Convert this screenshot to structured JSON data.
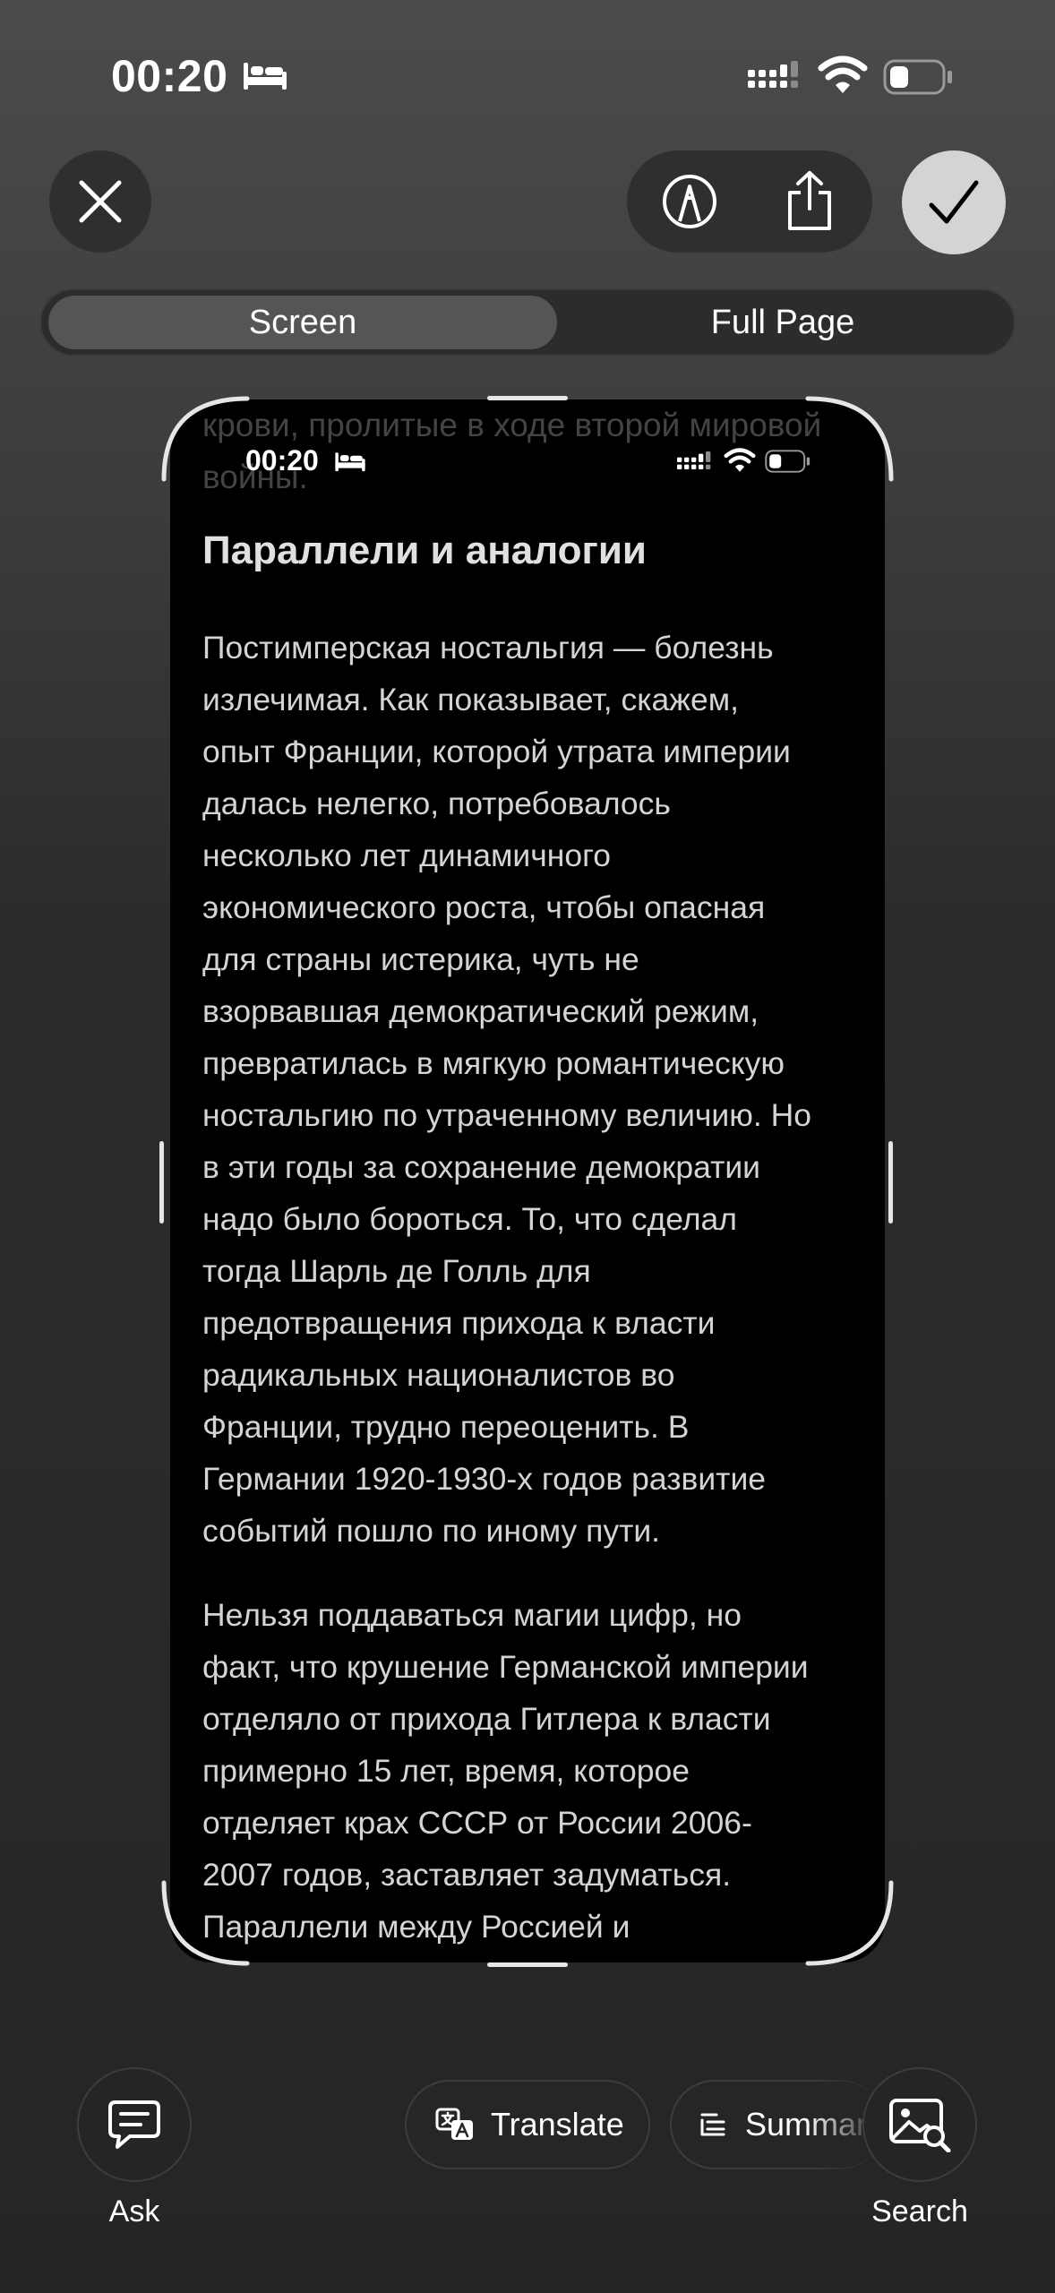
{
  "status_bar": {
    "time": "00:20"
  },
  "toolbar": {
    "close": "close",
    "markup": "markup",
    "share": "share",
    "done": "done"
  },
  "segments": {
    "screen": "Screen",
    "full_page": "Full Page"
  },
  "screenshot": {
    "behind_text": [
      "крови, пролитые в ходе второй мировой",
      "войны."
    ],
    "status_time": "00:20",
    "heading": "Параллели и аналогии",
    "paragraph1": [
      "Постимперская ностальгия — болезнь",
      "излечимая. Как показывает, скажем,",
      "опыт Франции, которой утрата империи",
      "далась нелегко, потребовалось",
      "несколько лет динамичного",
      "экономического роста, чтобы опасная",
      "для страны истерика, чуть не",
      "взорвавшая демократический режим,",
      "превратилась в мягкую романтическую",
      "ностальгию по утраченному величию. Но",
      "в эти годы за сохранение демократии",
      "надо было бороться. То, что сделал",
      "тогда Шарль де Голль для",
      "предотвращения прихода к власти",
      "радикальных националистов во",
      "Франции, трудно переоценить. В",
      "Германии 1920-1930-х годов развитие",
      "событий пошло по иному пути."
    ],
    "paragraph2": [
      "Нельзя поддаваться магии цифр, но",
      "факт, что крушение Германской империи",
      "отделяло от прихода Гитлера к власти",
      "примерно 15 лет, время, которое",
      "отделяет крах СССР от России 2006-",
      "2007 годов, заставляет задуматься.",
      "Параллели между Россией и"
    ]
  },
  "bottom": {
    "ask_label": "Ask",
    "translate_label": "Translate",
    "summarize_label": "Summar",
    "search_label": "Search"
  },
  "colors": {
    "background": "#2a2a2a",
    "done_button": "#d4d4d4",
    "selected_segment": "#555555"
  }
}
